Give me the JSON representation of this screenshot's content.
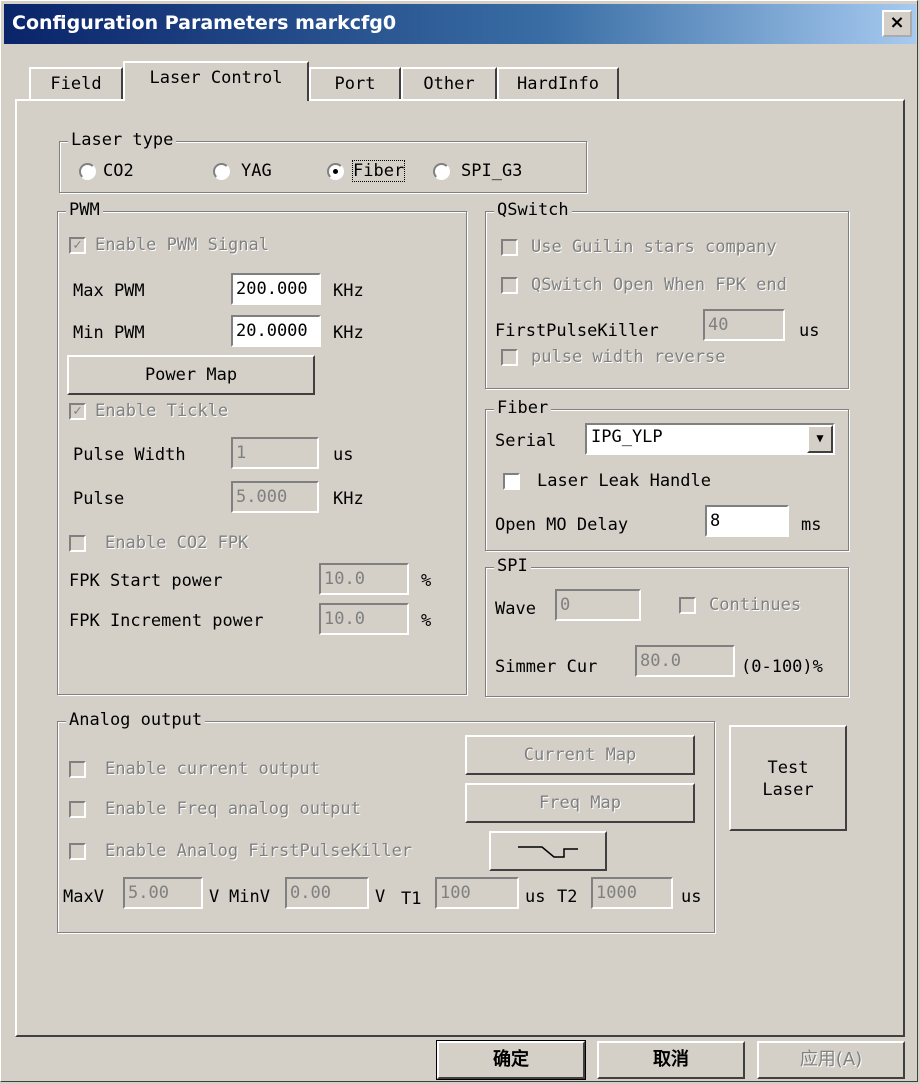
{
  "window": {
    "title": "Configuration Parameters markcfg0",
    "close": "×"
  },
  "tabs": [
    {
      "label": "Field"
    },
    {
      "label": "Laser Control"
    },
    {
      "label": "Port"
    },
    {
      "label": "Other"
    },
    {
      "label": "HardInfo"
    }
  ],
  "laser_type": {
    "title": "Laser type",
    "options": [
      "CO2",
      "YAG",
      "Fiber",
      "SPI_G3"
    ],
    "selected": "Fiber"
  },
  "pwm": {
    "title": "PWM",
    "enable_pwm": "Enable PWM Signal",
    "max_pwm_label": "Max PWM",
    "max_pwm_value": "200.000",
    "min_pwm_label": "Min PWM",
    "min_pwm_value": "20.0000",
    "khz": "KHz",
    "power_map": "Power Map",
    "enable_tickle": "Enable Tickle",
    "pulse_width_label": "Pulse Width",
    "pulse_width_value": "1",
    "us": "us",
    "pulse_label": "Pulse",
    "pulse_value": "5.000",
    "enable_co2_fpk": "Enable CO2 FPK",
    "fpk_start_label": "FPK Start power",
    "fpk_start_value": "10.0",
    "fpk_inc_label": "FPK Increment power",
    "fpk_inc_value": "10.0",
    "percent": "%"
  },
  "qswitch": {
    "title": "QSwitch",
    "guilin": "Use Guilin stars company",
    "open_fpk": "QSwitch Open When FPK end",
    "fpk_label": "FirstPulseKiller",
    "fpk_value": "40",
    "us": "us",
    "pulse_rev": "pulse width reverse"
  },
  "fiber": {
    "title": "Fiber",
    "serial_label": "Serial",
    "serial_value": "IPG_YLP",
    "leak": "Laser Leak Handle",
    "mo_label": "Open MO Delay",
    "mo_value": "8",
    "ms": "ms"
  },
  "spi": {
    "title": "SPI",
    "wave_label": "Wave",
    "wave_value": "0",
    "continues": "Continues",
    "simmer_label": "Simmer Cur",
    "simmer_value": "80.0",
    "range": "(0-100)%"
  },
  "analog": {
    "title": "Analog output",
    "enable_current": "Enable current output",
    "enable_freq": "Enable Freq analog output",
    "enable_fpk": "Enable Analog FirstPulseKiller",
    "current_map": "Current Map",
    "freq_map": "Freq Map",
    "maxv_label": "MaxV",
    "maxv_value": "5.00",
    "v1": "V",
    "minv_label": "MinV",
    "minv_value": "0.00",
    "v2": "V",
    "t1_label": "T1",
    "t1_value": "100",
    "us1": "us",
    "t2_label": "T2",
    "t2_value": "1000",
    "us2": "us"
  },
  "test_laser": {
    "line1": "Test",
    "line2": "Laser"
  },
  "footer": {
    "ok": "确定",
    "cancel": "取消",
    "apply": "应用(A)"
  }
}
